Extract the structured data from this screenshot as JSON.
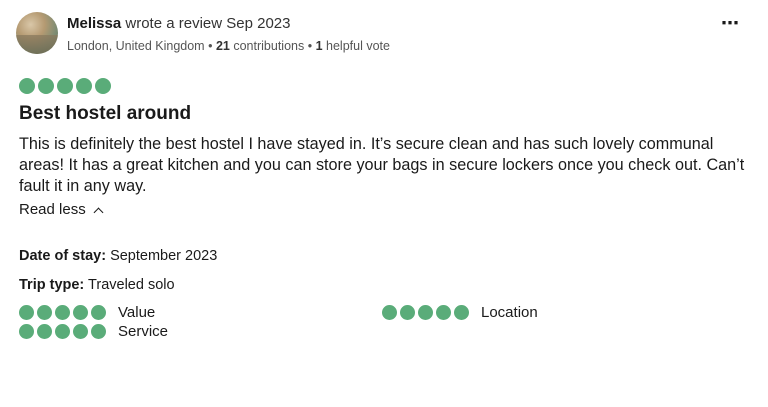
{
  "review": {
    "author": "Melissa",
    "action": "wrote a review Sep 2023",
    "location": "London, United Kingdom",
    "separator": "•",
    "contributions_count": "21",
    "contributions_label": "contributions",
    "helpful_count": "1",
    "helpful_label": "helpful vote",
    "more_icon": "⋯",
    "overall_rating": 5,
    "title": "Best hostel around",
    "body": "This is definitely the best hostel I have stayed in. It’s secure clean and has such lovely communal areas! It has a great kitchen and you can store your bags in secure lockers once you check out. Can’t fault it in any way.",
    "read_less": "Read less",
    "date_of_stay_label": "Date of stay:",
    "date_of_stay_value": "September 2023",
    "trip_type_label": "Trip type:",
    "trip_type_value": "Traveled solo",
    "sub_ratings": {
      "value": {
        "label": "Value",
        "rating": 5
      },
      "service": {
        "label": "Service",
        "rating": 5
      },
      "location": {
        "label": "Location",
        "rating": 5
      }
    }
  },
  "colors": {
    "bubble": "#5aac79",
    "text": "#1a1a1a",
    "meta": "#555555"
  }
}
